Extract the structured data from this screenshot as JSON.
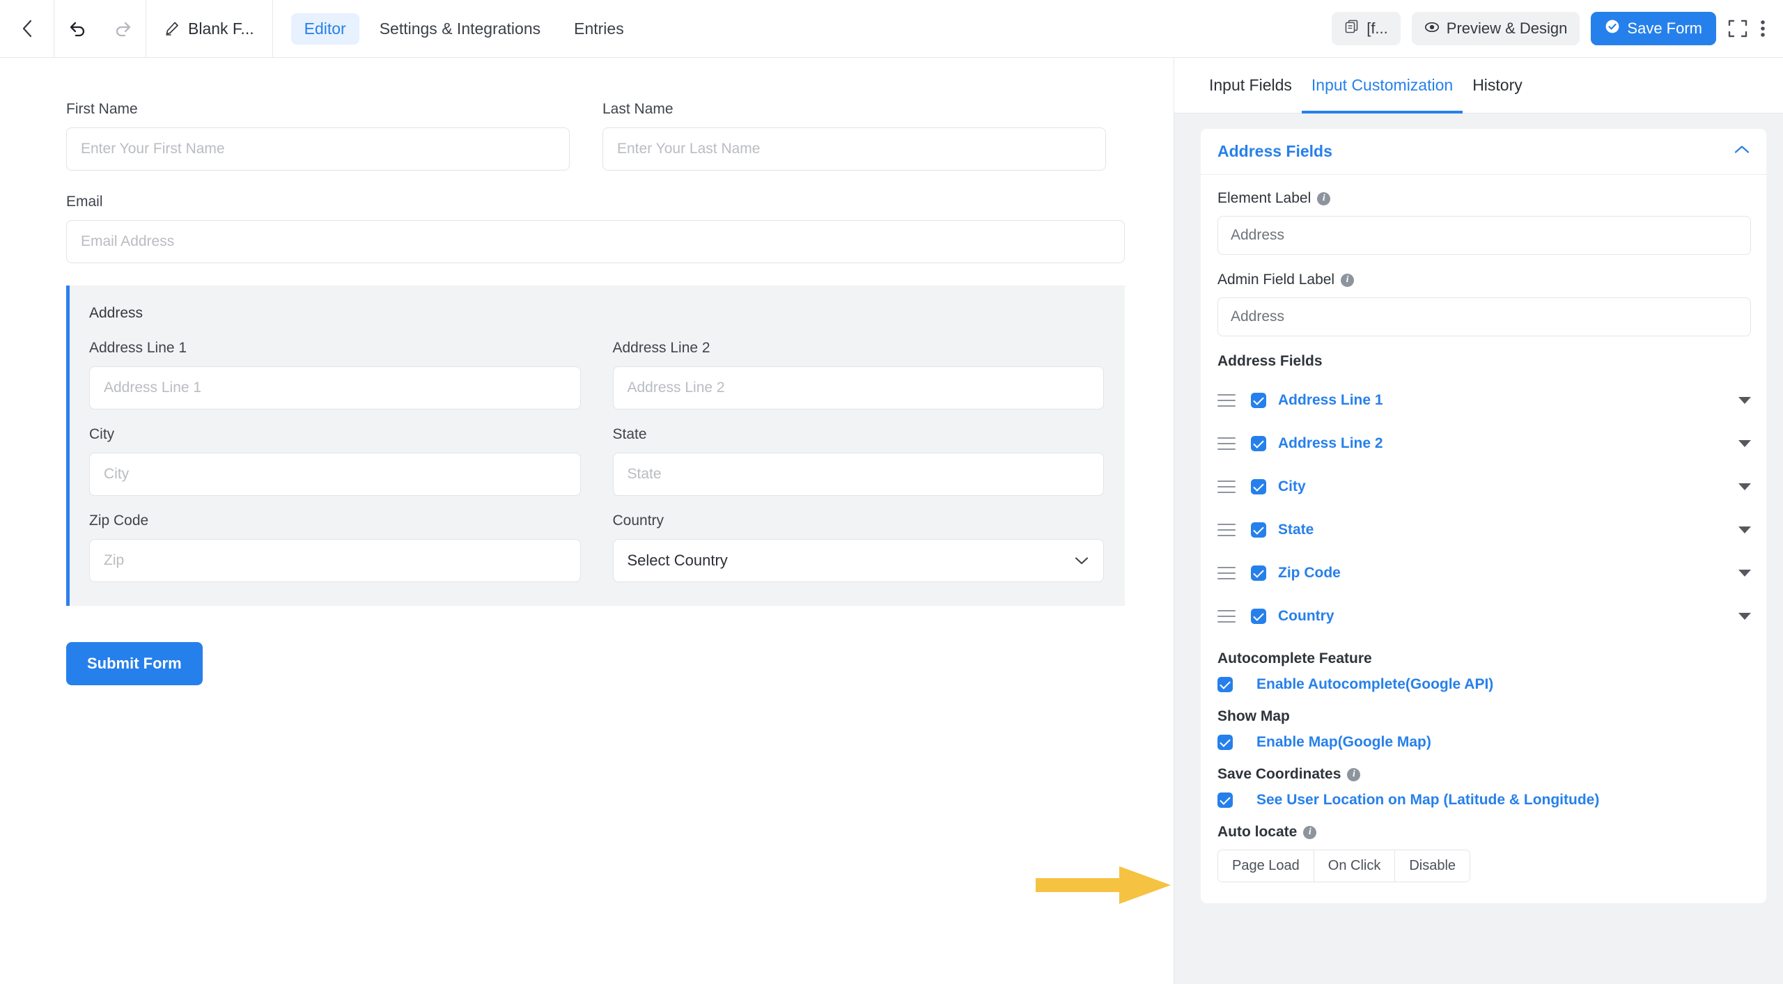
{
  "topbar": {
    "back_icon": "chevron-left-icon",
    "undo_icon": "undo-arrow-icon",
    "redo_icon": "redo-arrow-icon",
    "form_title": "Blank F...",
    "edit_icon": "pencil-edit-icon",
    "nav_tabs": [
      {
        "label": "Editor",
        "active": true
      },
      {
        "label": "Settings & Integrations",
        "active": false
      },
      {
        "label": "Entries",
        "active": false
      }
    ],
    "shortcode_button": {
      "label": "[f...",
      "icon": "copy-icon"
    },
    "preview_button": {
      "label": "Preview & Design",
      "icon": "eye-icon"
    },
    "save_button": {
      "label": "Save Form",
      "icon": "check-circle-icon"
    },
    "fullscreen_icon": "fullscreen-expand-icon",
    "more_icon": "more-vertical-icon"
  },
  "form": {
    "first_name": {
      "label": "First Name",
      "placeholder": "Enter Your First Name",
      "value": ""
    },
    "last_name": {
      "label": "Last Name",
      "placeholder": "Enter Your Last Name",
      "value": ""
    },
    "email": {
      "label": "Email",
      "placeholder": "Email Address",
      "value": ""
    },
    "address_group": {
      "title": "Address",
      "line1": {
        "label": "Address Line 1",
        "placeholder": "Address Line 1",
        "value": ""
      },
      "line2": {
        "label": "Address Line 2",
        "placeholder": "Address Line 2",
        "value": ""
      },
      "city": {
        "label": "City",
        "placeholder": "City",
        "value": ""
      },
      "state": {
        "label": "State",
        "placeholder": "State",
        "value": ""
      },
      "zip": {
        "label": "Zip Code",
        "placeholder": "Zip",
        "value": ""
      },
      "country": {
        "label": "Country",
        "selected": "Select Country"
      }
    },
    "submit_label": "Submit Form"
  },
  "panel": {
    "tabs": [
      {
        "label": "Input Fields",
        "active": false
      },
      {
        "label": "Input Customization",
        "active": true
      },
      {
        "label": "History",
        "active": false
      }
    ],
    "card_title": "Address Fields",
    "collapse_icon": "chevron-up-icon",
    "element_label": {
      "label": "Element Label",
      "placeholder": "Address",
      "value": ""
    },
    "admin_field_label": {
      "label": "Admin Field Label",
      "placeholder": "Address",
      "value": ""
    },
    "address_fields_heading": "Address Fields",
    "address_fields": [
      {
        "label": "Address Line 1",
        "checked": true
      },
      {
        "label": "Address Line 2",
        "checked": true
      },
      {
        "label": "City",
        "checked": true
      },
      {
        "label": "State",
        "checked": true
      },
      {
        "label": "Zip Code",
        "checked": true
      },
      {
        "label": "Country",
        "checked": true
      }
    ],
    "autocomplete_heading": "Autocomplete Feature",
    "autocomplete_option": {
      "label": "Enable Autocomplete(Google API)",
      "checked": true
    },
    "show_map_heading": "Show Map",
    "show_map_option": {
      "label": "Enable Map(Google Map)",
      "checked": true
    },
    "save_coordinates_heading": "Save Coordinates",
    "save_coordinates_option": {
      "label": "See User Location on Map (Latitude & Longitude)",
      "checked": true
    },
    "auto_locate_heading": "Auto locate",
    "auto_locate_options": [
      "Page Load",
      "On Click",
      "Disable"
    ]
  },
  "annotation": {
    "arrow_icon": "right-arrow-annotation",
    "color": "#F5C242"
  },
  "colors": {
    "accent_blue": "#2680eb",
    "panel_bg": "#f1f2f4",
    "group_bg": "#f2f3f4",
    "group_border": "#2e7ef0",
    "annotation_yellow": "#F5C242"
  }
}
